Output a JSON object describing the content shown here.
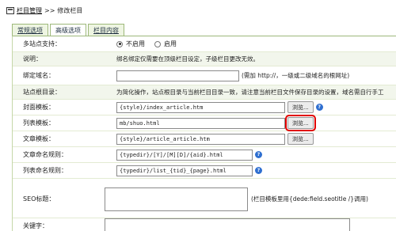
{
  "breadcrumb": {
    "root": "栏目管理",
    "separator": ">>",
    "current": "修改栏目"
  },
  "tabs": [
    {
      "label": "常规选项"
    },
    {
      "label": "高级选项"
    },
    {
      "label": "栏目内容"
    }
  ],
  "rows": {
    "multisite": {
      "label": "多站点支持：",
      "opt_off": "不启用",
      "opt_on": "启用"
    },
    "explain": {
      "label": "说明：",
      "text": "绑名绑定仅需要在顶级栏目设定，子级栏目更改无效。"
    },
    "domain": {
      "label": "绑定域名：",
      "value": "",
      "hint": "(需加 http://，一级或二级域名的根网址)"
    },
    "siteroot": {
      "label": "站点根目录：",
      "text": "为简化操作，站点根目录与当前栏目目录一致，请注意当前栏目文件保存目录的设置，域名需自行手工"
    },
    "index_tpl": {
      "label": "封面模板：",
      "value": "{style}/index_article.htm",
      "button": "浏览..."
    },
    "list_tpl": {
      "label": "列表模板：",
      "value": "mb/shuo.html",
      "button": "浏览..."
    },
    "article_tpl": {
      "label": "文章模板：",
      "value": "{style}/article_article.htm",
      "button": "浏览..."
    },
    "article_rule": {
      "label": "文章命名规则：",
      "value": "{typedir}/[Y]/[M][D]/{aid}.html"
    },
    "list_rule": {
      "label": "列表命名规则：",
      "value": "{typedir}/list_{tid}_{page}.html"
    },
    "seo": {
      "label": "SEO标题：",
      "hint": "(栏目模板里用{dede:field.seotitle /}调用)"
    },
    "keywords": {
      "label": "关键字："
    }
  },
  "icons": {
    "help": "?",
    "breadcrumb": "folder-icon"
  },
  "colors": {
    "highlight": "#e10000",
    "tab_border": "#9db87a",
    "help_icon": "#2f6fd0"
  }
}
